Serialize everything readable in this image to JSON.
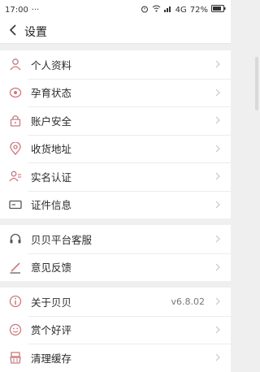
{
  "status": {
    "time": "17:00",
    "dots": "···",
    "signal": "4G",
    "battery": "72%"
  },
  "nav": {
    "title": "设置"
  },
  "groups": [
    {
      "items": [
        {
          "label": "个人资料",
          "icon": "person-icon"
        },
        {
          "label": "孕育状态",
          "icon": "pregnancy-icon"
        },
        {
          "label": "账户安全",
          "icon": "lock-icon"
        },
        {
          "label": "收货地址",
          "icon": "location-icon"
        },
        {
          "label": "实名认证",
          "icon": "id-verify-icon"
        },
        {
          "label": "证件信息",
          "icon": "card-icon"
        }
      ]
    },
    {
      "items": [
        {
          "label": "贝贝平台客服",
          "icon": "headset-icon"
        },
        {
          "label": "意见反馈",
          "icon": "pen-icon"
        }
      ]
    },
    {
      "items": [
        {
          "label": "关于贝贝",
          "icon": "info-icon",
          "value": "v6.8.02"
        },
        {
          "label": "赏个好评",
          "icon": "smile-icon"
        },
        {
          "label": "清理缓存",
          "icon": "broom-icon"
        }
      ]
    }
  ],
  "colors": {
    "accent": "#c97a7f",
    "chevron": "#c7c7c7"
  }
}
